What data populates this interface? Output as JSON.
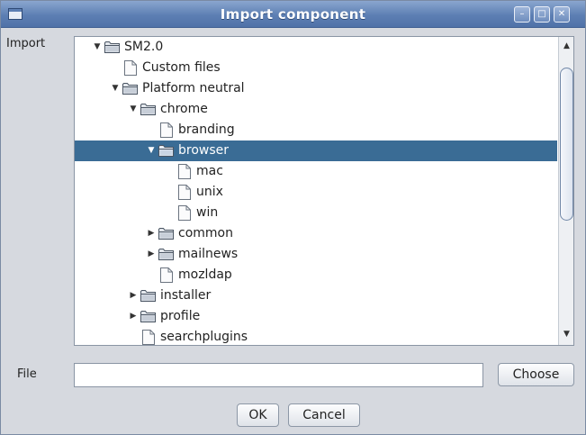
{
  "window": {
    "title": "Import component",
    "controls": {
      "minimize": "–",
      "maximize": "□",
      "close": "✕"
    }
  },
  "labels": {
    "import": "Import",
    "file": "File"
  },
  "tree": {
    "nodes": [
      {
        "label": "SM2.0",
        "type": "folder",
        "expanded": true,
        "depth": 0
      },
      {
        "label": "Custom files",
        "type": "file",
        "depth": 1
      },
      {
        "label": "Platform neutral",
        "type": "folder",
        "expanded": true,
        "depth": 1
      },
      {
        "label": "chrome",
        "type": "folder",
        "expanded": true,
        "depth": 2
      },
      {
        "label": "branding",
        "type": "file",
        "depth": 3
      },
      {
        "label": "browser",
        "type": "folder",
        "expanded": true,
        "selected": true,
        "depth": 3
      },
      {
        "label": "mac",
        "type": "file",
        "depth": 4
      },
      {
        "label": "unix",
        "type": "file",
        "depth": 4
      },
      {
        "label": "win",
        "type": "file",
        "depth": 4
      },
      {
        "label": "common",
        "type": "folder",
        "expanded": false,
        "depth": 3
      },
      {
        "label": "mailnews",
        "type": "folder",
        "expanded": false,
        "depth": 3
      },
      {
        "label": "mozldap",
        "type": "file",
        "depth": 3
      },
      {
        "label": "installer",
        "type": "folder",
        "expanded": false,
        "depth": 2
      },
      {
        "label": "profile",
        "type": "folder",
        "expanded": false,
        "depth": 2
      },
      {
        "label": "searchplugins",
        "type": "file",
        "depth": 2
      }
    ]
  },
  "file_field": {
    "value": "",
    "placeholder": ""
  },
  "buttons": {
    "choose": "Choose",
    "ok": "OK",
    "cancel": "Cancel"
  },
  "colors": {
    "titlebar": "#5d7fb3",
    "selection": "#3a6c95",
    "background": "#d6d9df"
  },
  "icons": {
    "folder": "folder-icon",
    "file": "file-icon",
    "expanded": "▼",
    "collapsed": "▶",
    "scroll_up": "▲",
    "scroll_down": "▼"
  }
}
